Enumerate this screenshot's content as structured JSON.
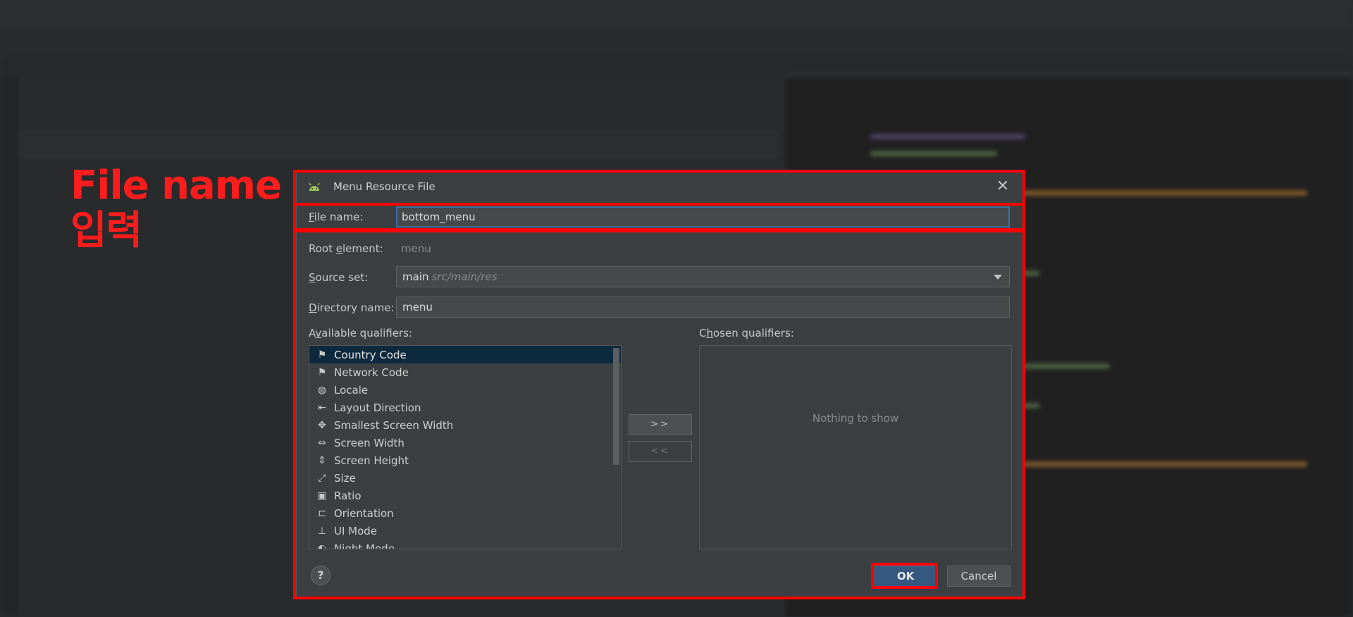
{
  "annotation": {
    "line1": "File name",
    "line2": "입력",
    "color": "#ff1c1c"
  },
  "dialog": {
    "title": "Menu Resource File",
    "close_icon": "close-icon",
    "file_name": {
      "label_prefix": "F",
      "label_rest": "ile name:",
      "value": "bottom_menu"
    },
    "root_element": {
      "label_prefix": "Root ",
      "label_underline": "e",
      "label_rest": "lement:",
      "value": "menu"
    },
    "source_set": {
      "label_prefix": "S",
      "label_rest": "ource set:",
      "value": "main",
      "hint": "src/main/res"
    },
    "directory_name": {
      "label_prefix": "D",
      "label_rest": "irectory name:",
      "value": "menu"
    },
    "available_qualifiers": {
      "label_prefix": "A",
      "label_underline": "v",
      "label_rest": "ailable qualifiers:",
      "items": [
        {
          "label": "Country Code",
          "icon": "country-code-icon",
          "glyph": "⚑",
          "selected": true
        },
        {
          "label": "Network Code",
          "icon": "network-code-icon",
          "glyph": "⚑",
          "selected": false
        },
        {
          "label": "Locale",
          "icon": "globe-icon",
          "glyph": "◍",
          "selected": false
        },
        {
          "label": "Layout Direction",
          "icon": "layout-direction-icon",
          "glyph": "⇤",
          "selected": false
        },
        {
          "label": "Smallest Screen Width",
          "icon": "smallest-screen-width-icon",
          "glyph": "✥",
          "selected": false
        },
        {
          "label": "Screen Width",
          "icon": "screen-width-icon",
          "glyph": "⇔",
          "selected": false
        },
        {
          "label": "Screen Height",
          "icon": "screen-height-icon",
          "glyph": "⇕",
          "selected": false
        },
        {
          "label": "Size",
          "icon": "size-icon",
          "glyph": "⤢",
          "selected": false
        },
        {
          "label": "Ratio",
          "icon": "ratio-icon",
          "glyph": "▣",
          "selected": false
        },
        {
          "label": "Orientation",
          "icon": "orientation-icon",
          "glyph": "⊏",
          "selected": false
        },
        {
          "label": "UI Mode",
          "icon": "ui-mode-icon",
          "glyph": "⊥",
          "selected": false
        },
        {
          "label": "Night Mode",
          "icon": "night-mode-icon",
          "glyph": "◐",
          "selected": false
        }
      ]
    },
    "chosen_qualifiers": {
      "label_prefix": "C",
      "label_underline": "h",
      "label_rest": "osen qualifiers:",
      "empty_text": "Nothing to show"
    },
    "add_button": ">>",
    "remove_button": "<<",
    "help_button": "?",
    "ok_button": "OK",
    "cancel_button": "Cancel"
  }
}
